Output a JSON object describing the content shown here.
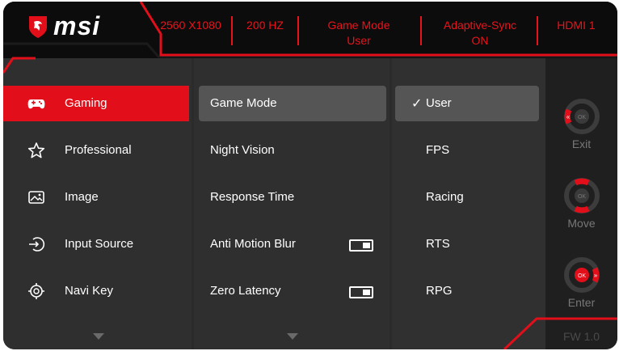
{
  "header": {
    "brand": "msi",
    "status": [
      {
        "line1": "2560 X1080",
        "line2": ""
      },
      {
        "line1": "200 HZ",
        "line2": ""
      },
      {
        "line1": "Game Mode",
        "line2": "User"
      },
      {
        "line1": "Adaptive-Sync",
        "line2": "ON"
      },
      {
        "line1": "HDMI 1",
        "line2": ""
      }
    ]
  },
  "main_menu": {
    "items": [
      {
        "label": "Gaming",
        "icon": "gamepad-icon",
        "active": true
      },
      {
        "label": "Professional",
        "icon": "star-icon",
        "active": false
      },
      {
        "label": "Image",
        "icon": "image-icon",
        "active": false
      },
      {
        "label": "Input Source",
        "icon": "input-source-icon",
        "active": false
      },
      {
        "label": "Navi Key",
        "icon": "navi-key-icon",
        "active": false
      }
    ]
  },
  "sub_menu": {
    "items": [
      {
        "label": "Game Mode",
        "active": true
      },
      {
        "label": "Night Vision"
      },
      {
        "label": "Response Time"
      },
      {
        "label": "Anti Motion Blur",
        "toggle": "on"
      },
      {
        "label": "Zero Latency",
        "toggle": "on"
      }
    ]
  },
  "options": {
    "items": [
      {
        "label": "User",
        "selected": true
      },
      {
        "label": "FPS"
      },
      {
        "label": "Racing"
      },
      {
        "label": "RTS"
      },
      {
        "label": "RPG"
      }
    ]
  },
  "navi_guide": {
    "exit_label": "Exit",
    "move_label": "Move",
    "enter_label": "Enter",
    "ok_label": "OK",
    "firmware": "FW 1.0"
  },
  "colors": {
    "accent": "#e20f1a",
    "panel": "#2f2f2f",
    "highlight": "#555555",
    "header_bg": "#0c0c0c"
  }
}
